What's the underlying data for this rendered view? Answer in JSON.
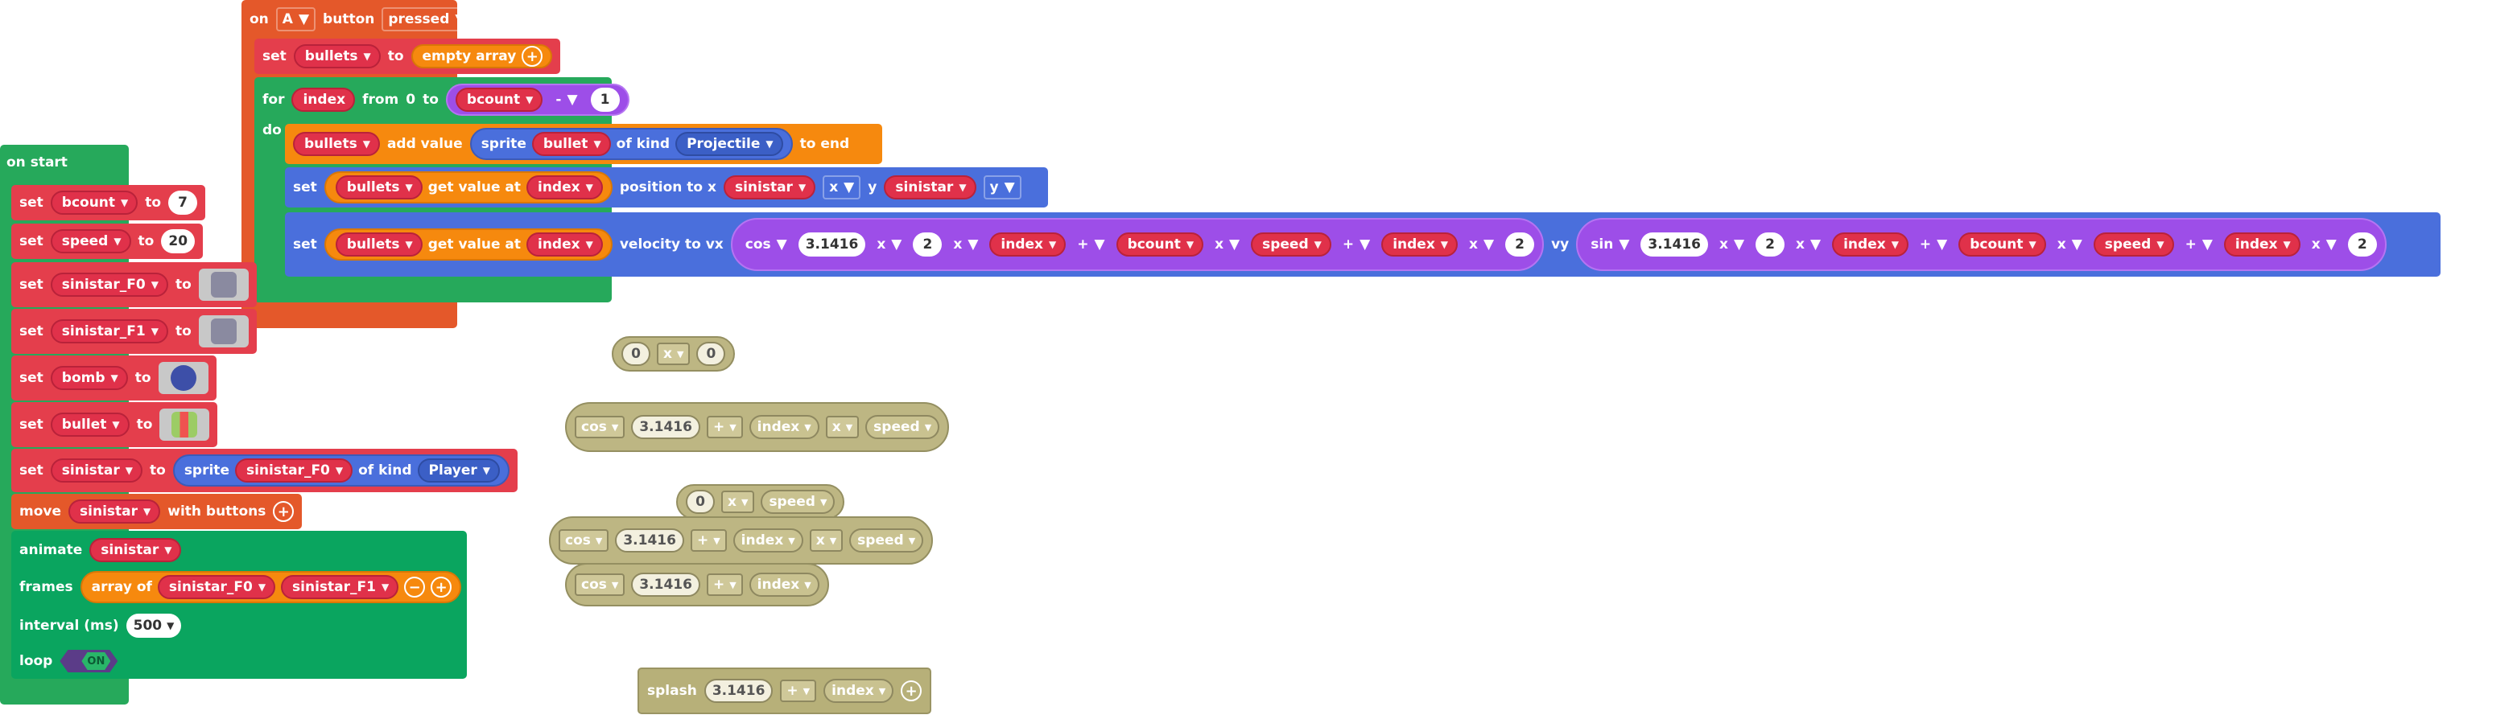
{
  "colors": {
    "event_orange": "#e4582a",
    "set_red": "#e43e4c",
    "loop_green": "#26a95b",
    "array_orange": "#f6890e",
    "sprite_blue": "#4a6fdc",
    "math_purple": "#9d4ee8",
    "ghost": "#bdb683",
    "anim_green": "#0aa55f"
  },
  "on_a": {
    "on": "on",
    "button": "A",
    "button_word": "button",
    "event": "pressed",
    "set1": {
      "set": "set",
      "var": "bullets",
      "to": "to",
      "value": "empty array"
    },
    "for": {
      "for": "for",
      "index": "index",
      "from": "from",
      "start": "0",
      "to": "to",
      "var": "bcount",
      "op": "-",
      "num": "1",
      "do": "do"
    },
    "add": {
      "var": "bullets",
      "add": "add value",
      "sprite": "sprite",
      "sprite_var": "bullet",
      "of_kind": "of kind",
      "kind": "Projectile",
      "to_end": "to end"
    },
    "setpos": {
      "set": "set",
      "arr": "bullets",
      "get": "get value at",
      "idx": "index",
      "prop": "position to x",
      "x_var": "sinistar",
      "x_prop": "x",
      "y": "y",
      "y_var": "sinistar",
      "y_prop": "y"
    },
    "setvel": {
      "set": "set",
      "arr": "bullets",
      "get": "get value at",
      "idx": "index",
      "prop": "velocity to vx",
      "vx": {
        "fn": "cos",
        "pi": "3.1416",
        "op1": "x",
        "two": "2",
        "op2": "x",
        "idx": "index",
        "op3": "+",
        "bcount": "bcount",
        "op4": "x",
        "speed": "speed",
        "op5": "+",
        "idx2": "index",
        "op6": "x",
        "two2": "2"
      },
      "vy_label": "vy",
      "vy": {
        "fn": "sin",
        "pi": "3.1416",
        "op1": "x",
        "two": "2",
        "op2": "x",
        "idx": "index",
        "op3": "+",
        "bcount": "bcount",
        "op4": "x",
        "speed": "speed",
        "op5": "+",
        "idx2": "index",
        "op6": "x",
        "two2": "2"
      }
    }
  },
  "on_start": {
    "title": "on start",
    "rows": [
      {
        "set": "set",
        "var": "bcount",
        "to": "to",
        "value": "7"
      },
      {
        "set": "set",
        "var": "speed",
        "to": "to",
        "value": "20"
      },
      {
        "set": "set",
        "var": "sinistar_F0",
        "to": "to"
      },
      {
        "set": "set",
        "var": "sinistar_F1",
        "to": "to"
      },
      {
        "set": "set",
        "var": "bomb",
        "to": "to"
      },
      {
        "set": "set",
        "var": "bullet",
        "to": "to"
      }
    ],
    "sprite_row": {
      "set": "set",
      "var": "sinistar",
      "to": "to",
      "sprite": "sprite",
      "img": "sinistar_F0",
      "of_kind": "of kind",
      "kind": "Player"
    },
    "move": {
      "move": "move",
      "var": "sinistar",
      "with": "with buttons"
    },
    "animate": {
      "animate": "animate",
      "var": "sinistar",
      "frames": "frames",
      "array_of": "array of",
      "f0": "sinistar_F0",
      "f1": "sinistar_F1",
      "interval": "interval (ms)",
      "ms": "500",
      "loop": "loop",
      "on": "ON"
    }
  },
  "ghosts": {
    "g1": {
      "a": "0",
      "op": "x",
      "b": "0"
    },
    "g2": {
      "fn": "cos",
      "pi": "3.1416",
      "op": "+",
      "idx": "index",
      "op2": "x",
      "speed": "speed"
    },
    "g3": {
      "a": "0",
      "op": "x",
      "speed": "speed"
    },
    "g4": {
      "fn": "cos",
      "pi": "3.1416",
      "op": "+",
      "idx": "index",
      "op2": "x",
      "speed": "speed"
    },
    "g5": {
      "fn": "cos",
      "pi": "3.1416",
      "op": "+",
      "idx": "index"
    },
    "g6": {
      "splash": "splash",
      "pi": "3.1416",
      "op": "+",
      "idx": "index"
    }
  }
}
